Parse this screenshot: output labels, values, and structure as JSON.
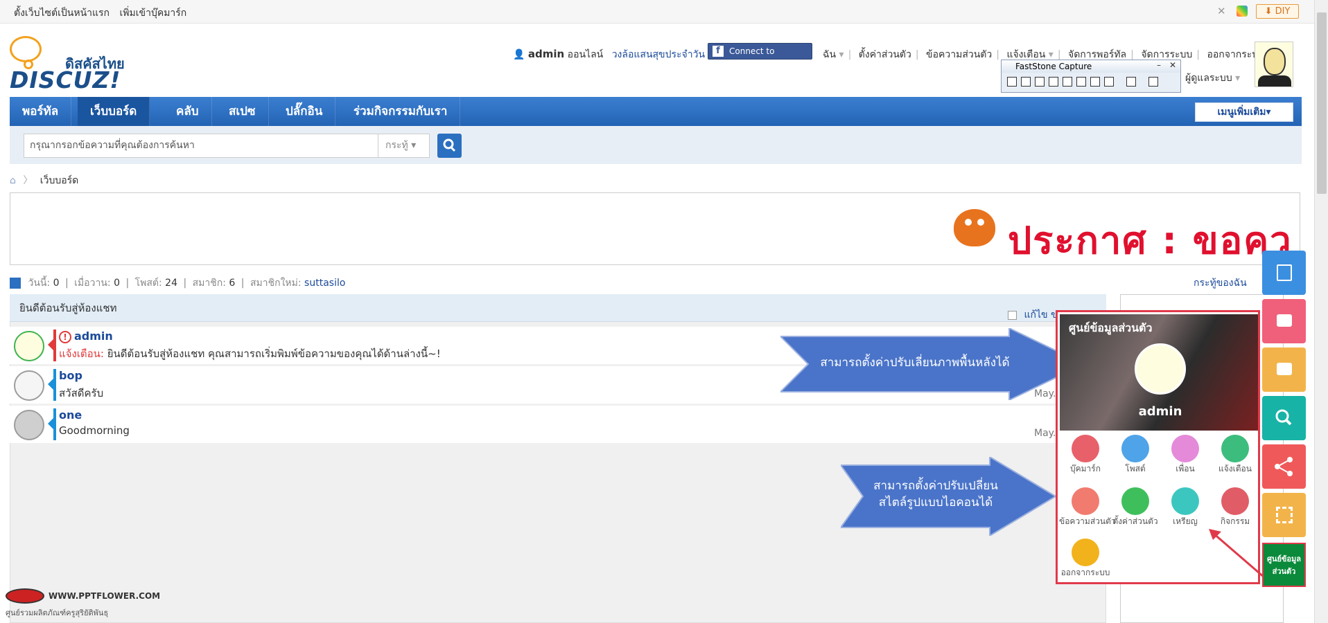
{
  "topbar": {
    "set_home": "ตั้งเว็บไซต์เป็นหน้าแรก",
    "bookmark": "เพิ่มเข้าบุ๊คมาร์ก",
    "diy": "DIY"
  },
  "logo": {
    "line1": "ดิสคัสไทย",
    "line2": "DISCUZ!"
  },
  "user": {
    "name": "admin",
    "status": "ออนไลน์",
    "lucky_wheel": "วงล้อแสนสุขประจำวัน",
    "fb_button": "Connect to Facebook",
    "menu": [
      "ฉัน",
      "ตั้งค่าส่วนตัว",
      "ข้อความส่วนตัว",
      "แจ้งเตือน",
      "จัดการพอร์ทัล",
      "จัดการระบบ",
      "ออกจากระบบ"
    ],
    "role": "ผู้ดูแลระบบ"
  },
  "faststone": {
    "title": "FastStone Capture"
  },
  "nav": {
    "items": [
      "พอร์ทัล",
      "เว็บบอร์ด",
      "คลับ",
      "สเปซ",
      "ปลั๊กอิน",
      "ร่วมกิจกรรมกับเรา"
    ],
    "active": "เว็บบอร์ด",
    "more": "เมนูเพิ่มเติม"
  },
  "search": {
    "placeholder": "กรุณากรอกข้อความที่คุณต้องการค้นหา",
    "type": "กระทู้"
  },
  "breadcrumb": {
    "current": "เว็บบอร์ด"
  },
  "notice": {
    "text": "ประกาศ : ขอคว"
  },
  "stats": {
    "today_label": "วันนี้:",
    "today": "0",
    "yesterday_label": "เมื่อวาน:",
    "yesterday": "0",
    "posts_label": "โพสต์:",
    "posts": "24",
    "members_label": "สมาชิก:",
    "members": "6",
    "newest_label": "สมาชิกใหม่:",
    "newest": "suttasilo",
    "my_threads": "กระทู้ของฉัน"
  },
  "chat": {
    "header": "ยินดีต้อนรับสู่ห้องแชท",
    "edit": "แก้ไข ขอ",
    "rows": [
      {
        "name": "admin",
        "warn_label": "แจ้งเตือน:",
        "msg": "ยินดีต้อนรับสู่ห้องแชท คุณสามารถเริ่มพิมพ์ข้อความของคุณได้ด้านล่างนี้~!",
        "time": ""
      },
      {
        "name": "bop",
        "msg": "สวัสดีครับ",
        "time": "May."
      },
      {
        "name": "one",
        "msg": "Goodmorning",
        "time": "May."
      }
    ]
  },
  "callouts": {
    "bg": "สามารถตั้งค่าปรับเลี่ยนภาพพื้นหลังได้",
    "icon_line1": "สามารถตั้งค่าปรับเปลี่ยน",
    "icon_line2": "สไตล์รูปแบบไอคอนได้"
  },
  "panel": {
    "title": "ศูนย์ข้อมูลส่วนตัว",
    "user": "admin",
    "items": [
      {
        "label": "บุ๊คมาร์ก",
        "color": "#e8606a"
      },
      {
        "label": "โพสต์",
        "color": "#4fa3e8"
      },
      {
        "label": "เพื่อน",
        "color": "#e48ad9"
      },
      {
        "label": "แจ้งเตือน",
        "color": "#3dbd7d"
      },
      {
        "label": "ข้อความส่วนตัว",
        "color": "#f07b6e"
      },
      {
        "label": "ตั้งค่าส่วนตัว",
        "color": "#3fbf5b"
      },
      {
        "label": "เหรียญ",
        "color": "#3bc7c0"
      },
      {
        "label": "กิจกรรม",
        "color": "#e05c66"
      },
      {
        "label": "ออกจากระบบ",
        "color": "#f2b21c"
      }
    ]
  },
  "sidebar": {
    "buttons": [
      {
        "icon": "edit-icon",
        "color": "#3b8fe0"
      },
      {
        "icon": "calendar-icon",
        "color": "#f0607a"
      },
      {
        "icon": "calendar-icon",
        "color": "#f2b44a"
      },
      {
        "icon": "search-icon",
        "color": "#17b3a6"
      },
      {
        "icon": "share-icon",
        "color": "#f0595a"
      },
      {
        "icon": "qrcode-icon",
        "color": "#f2b44a"
      }
    ],
    "profile_center": "ศูนย์ข้อมูลส่วนตัว"
  },
  "watermark": {
    "line1": "WWW.PPTFLOWER.COM",
    "line2": "ศูนย์รวมผลิตภัณฑ์ครูสุริยัติพันธุ"
  }
}
